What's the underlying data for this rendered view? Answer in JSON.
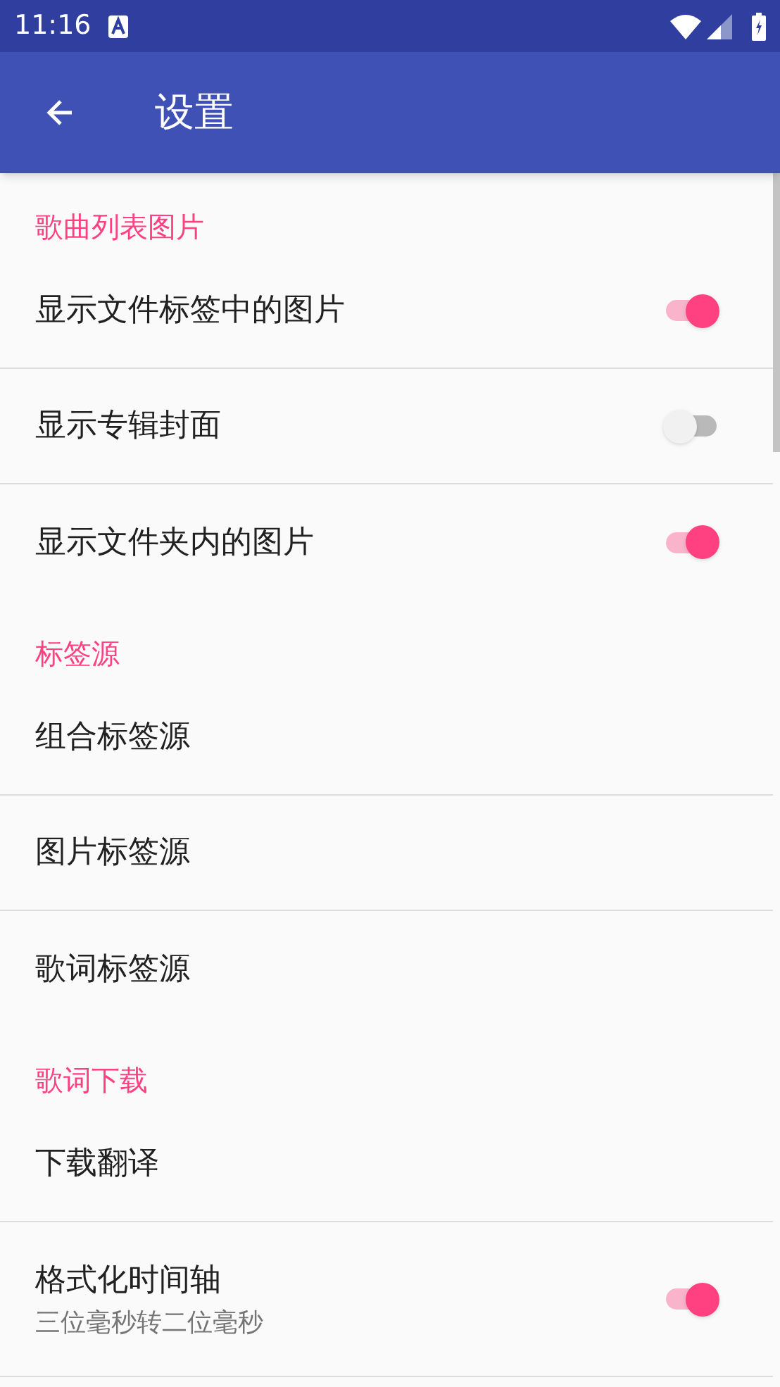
{
  "status_bar": {
    "time": "11:16"
  },
  "app_bar": {
    "title": "设置"
  },
  "sections": [
    {
      "title": "歌曲列表图片",
      "items": [
        {
          "kind": "toggle",
          "label": "显示文件标签中的图片",
          "on": true
        },
        {
          "kind": "toggle",
          "label": "显示专辑封面",
          "on": false
        },
        {
          "kind": "toggle",
          "label": "显示文件夹内的图片",
          "on": true
        }
      ]
    },
    {
      "title": "标签源",
      "items": [
        {
          "kind": "plain",
          "label": "组合标签源"
        },
        {
          "kind": "plain",
          "label": "图片标签源"
        },
        {
          "kind": "plain",
          "label": "歌词标签源"
        }
      ]
    },
    {
      "title": "歌词下载",
      "items": [
        {
          "kind": "plain",
          "label": "下载翻译"
        },
        {
          "kind": "toggle",
          "label": "格式化时间轴",
          "summary": "三位毫秒转二位毫秒",
          "on": true
        }
      ]
    }
  ]
}
